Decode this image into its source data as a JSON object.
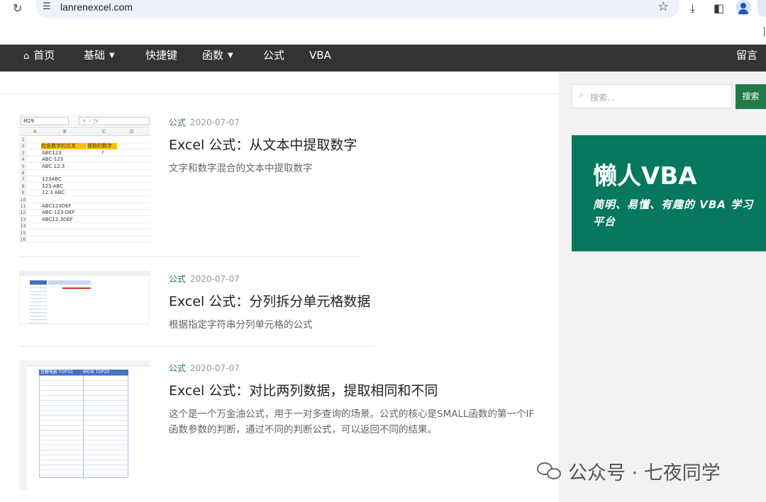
{
  "browser": {
    "url": "lanrenexcel.com",
    "reload_icon": "reload-icon",
    "star_icon": "bookmark-star-icon"
  },
  "nav": {
    "items": [
      {
        "label": "首页",
        "icon": "home-icon"
      },
      {
        "label": "基础",
        "dropdown": true
      },
      {
        "label": "快捷键"
      },
      {
        "label": "函数",
        "dropdown": true
      },
      {
        "label": "公式"
      },
      {
        "label": "VBA"
      }
    ],
    "right_item": "留言"
  },
  "posts": [
    {
      "category": "公式",
      "date": "2020-07-07",
      "title": "Excel 公式：从文本中提取数字",
      "excerpt": "文字和数字混合的文本中提取数字",
      "thumb": {
        "namebox": "M29",
        "cols": [
          "A",
          "B",
          "C",
          "D"
        ],
        "header_b": "包含数字的文本",
        "header_c": "提取的数字",
        "question": "?",
        "rows": [
          "",
          "",
          "ABC123",
          "ABC-123",
          "ABC 12.3",
          "",
          "123ABC",
          "123-ABC",
          "12.3 ABC",
          "",
          "ABC123DEF",
          "ABC-123-DEF",
          "ABC12.3DEF",
          "",
          "",
          ""
        ]
      }
    },
    {
      "category": "公式",
      "date": "2020-07-07",
      "title": "Excel 公式：分列拆分单元格数据",
      "excerpt": "根据指定字符串分列单元格的公式"
    },
    {
      "category": "公式",
      "date": "2020-07-07",
      "title": "Excel 公式：对比两列数据，提取相同和不同",
      "excerpt": "这个是一个万金油公式，用于一对多查询的场景。公式的核心是SMALL函数的第一个IF函数参数的判断，通过不同的判断公式，可以返回不同的结果。",
      "thumb": {
        "header_b": "豆瓣电影 TOP20",
        "header_c": "IMDB TOP20"
      }
    }
  ],
  "sidebar": {
    "search_placeholder": "搜索...",
    "search_button": "搜索",
    "promo_title": "懒人VBA",
    "promo_subtitle": "简明、易懂、有趣的 VBA 学习平台"
  },
  "watermark": "公众号 · 七夜同学",
  "colors": {
    "nav_bg": "#333333",
    "accent_green": "#207b49",
    "promo_bg": "#05785d",
    "category_green": "#2a7a3e"
  }
}
